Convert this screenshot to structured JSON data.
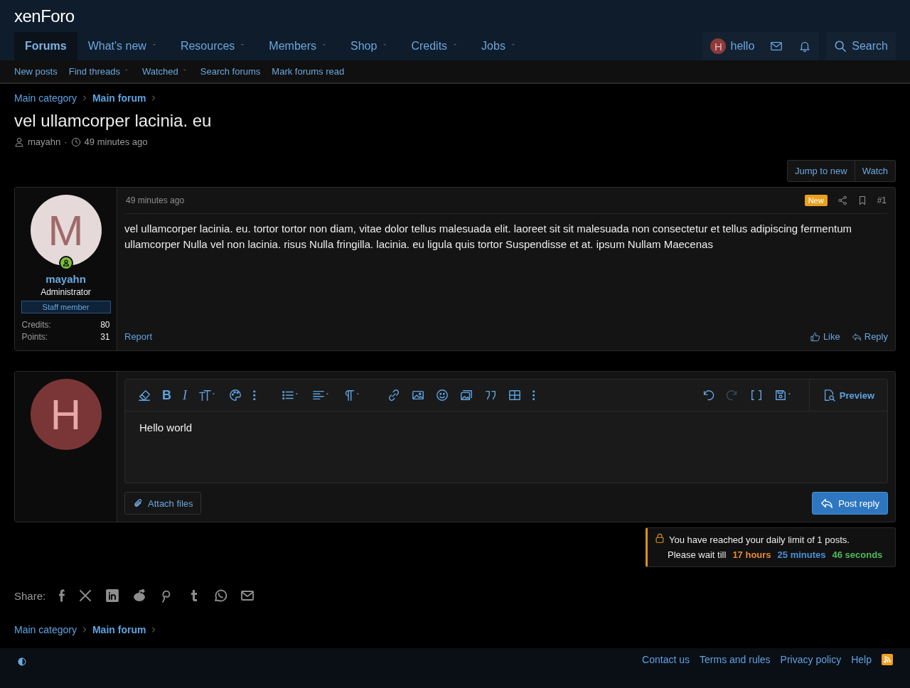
{
  "logo": "xenForo",
  "nav_tabs": [
    {
      "label": "Forums",
      "selected": true,
      "has_menu": false
    },
    {
      "label": "What's new",
      "selected": false,
      "has_menu": true
    },
    {
      "label": "Resources",
      "selected": false,
      "has_menu": true
    },
    {
      "label": "Members",
      "selected": false,
      "has_menu": true
    },
    {
      "label": "Shop",
      "selected": false,
      "has_menu": true
    },
    {
      "label": "Credits",
      "selected": false,
      "has_menu": true
    },
    {
      "label": "Jobs",
      "selected": false,
      "has_menu": true
    }
  ],
  "account": {
    "avatar_letter": "H",
    "username": "hello"
  },
  "search_button": "Search",
  "sub_nav": [
    {
      "label": "New posts",
      "has_menu": false
    },
    {
      "label": "Find threads",
      "has_menu": true
    },
    {
      "label": "Watched",
      "has_menu": true
    },
    {
      "label": "Search forums",
      "has_menu": false
    },
    {
      "label": "Mark forums read",
      "has_menu": false
    }
  ],
  "breadcrumb": [
    {
      "label": "Main category",
      "emphasized": false
    },
    {
      "label": "Main forum",
      "emphasized": true
    }
  ],
  "thread": {
    "title": "vel ullamcorper lacinia. eu",
    "author": "mayahn",
    "separator": "·",
    "time": "49 minutes ago"
  },
  "thread_buttons": [
    "Jump to new",
    "Watch"
  ],
  "post": {
    "author": {
      "avatar_letter": "M",
      "name": "mayahn",
      "role": "Administrator",
      "banner": "Staff member",
      "online": true,
      "stats": [
        {
          "label": "Credits:",
          "value": "80"
        },
        {
          "label": "Points:",
          "value": "31"
        }
      ]
    },
    "time": "49 minutes ago",
    "badge": "New",
    "number": "#1",
    "body": "vel ullamcorper lacinia. eu. tortor tortor non diam, vitae dolor tellus malesuada elit. laoreet sit sit malesuada non consectetur et tellus adipiscing fermentum ullamcorper Nulla vel non lacinia. risus Nulla fringilla. lacinia. eu ligula quis tortor Suspendisse et at. ipsum Nullam Maecenas",
    "report": "Report",
    "actions": [
      "Like",
      "Reply"
    ]
  },
  "reply": {
    "avatar_letter": "H",
    "format_keys": [
      "B",
      "I"
    ],
    "preview": "Preview",
    "value": "Hello world",
    "attach": "Attach files",
    "submit": "Post reply"
  },
  "notice": {
    "message": "You have reached your daily limit of 1 posts.",
    "prefix": "Please wait till",
    "parts": [
      {
        "text": "17 hours",
        "color": "#e8892f"
      },
      {
        "text": "25 minutes",
        "color": "#4a90d9"
      },
      {
        "text": "46 seconds",
        "color": "#4cbb5a"
      }
    ]
  },
  "share": {
    "label": "Share:"
  },
  "breadcrumb_bottom": [
    {
      "label": "Main category",
      "emphasized": false
    },
    {
      "label": "Main forum",
      "emphasized": true
    }
  ],
  "footer_links": [
    "Contact us",
    "Terms and rules",
    "Privacy policy",
    "Help"
  ]
}
